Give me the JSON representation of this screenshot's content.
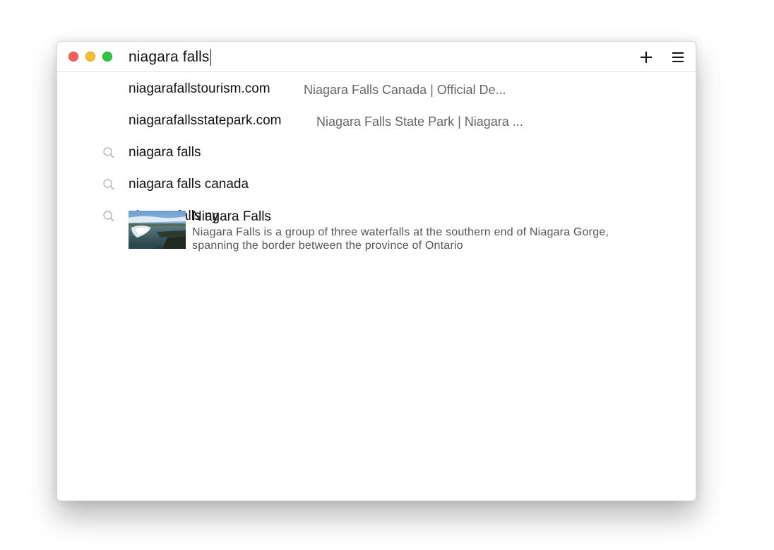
{
  "address_bar": {
    "value": "niagara falls"
  },
  "toolbar": {
    "new_tab_icon": "plus-icon",
    "menu_icon": "hamburger-menu-icon"
  },
  "suggestions": [
    {
      "type": "url",
      "main": "niagarafallstourism.com",
      "sub": "Niagara Falls Canada | Official De..."
    },
    {
      "type": "url",
      "main": "niagarafallsstatepark.com",
      "sub": "Niagara Falls State Park | Niagara ..."
    },
    {
      "type": "search",
      "main": "niagara falls",
      "icon": "search-icon"
    },
    {
      "type": "search",
      "main": "niagara falls canada",
      "icon": "search-icon"
    },
    {
      "type": "search",
      "main": "niagara falls ny",
      "icon": "search-icon"
    }
  ],
  "knowledge": {
    "title": "Niagara Falls",
    "description": "Niagara Falls is a group of three waterfalls at the southern end of Niagara Gorge, spanning the border between the province of Ontario"
  },
  "colors": {
    "close": "#fd5f57",
    "minimize": "#febc2e",
    "maximize": "#29c840"
  }
}
